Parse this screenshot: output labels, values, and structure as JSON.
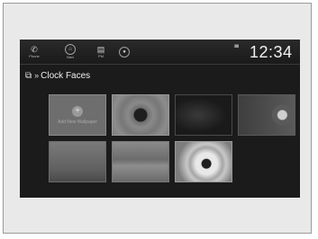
{
  "status_bar": {
    "buttons": [
      {
        "icon": "phone-icon",
        "label": "Phone"
      },
      {
        "icon": "home-icon",
        "label": "Navi"
      },
      {
        "icon": "list-icon",
        "label": "PM"
      },
      {
        "icon": "circle-icon",
        "label": ""
      }
    ],
    "clock": "12:34"
  },
  "header": {
    "breadcrumb_chevron": "»",
    "title": "Clock Faces"
  },
  "grid": {
    "add_tile_label": "Add New Wallpaper",
    "add_tile_plus": "+"
  }
}
